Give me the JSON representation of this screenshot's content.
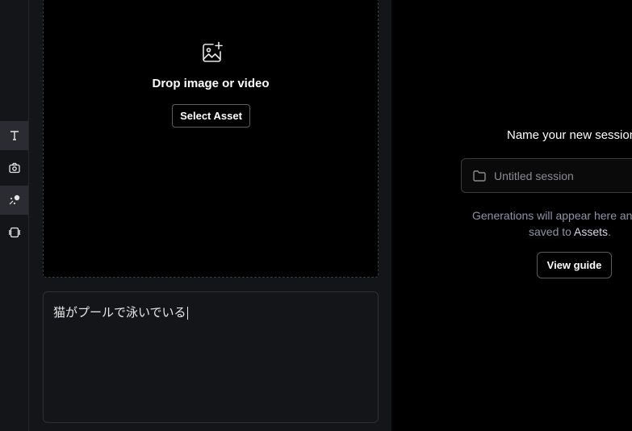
{
  "rail": {
    "items": [
      {
        "icon": "text-icon",
        "active": true
      },
      {
        "icon": "camera-icon",
        "active": false
      },
      {
        "icon": "motion-brush-icon",
        "active": true
      },
      {
        "icon": "layers-icon",
        "active": false
      }
    ]
  },
  "dropzone": {
    "icon": "image-add-icon",
    "title": "Drop image or video",
    "select_label": "Select Asset"
  },
  "prompt": {
    "value": "猫がプールで泳いでいる"
  },
  "session": {
    "title": "Name your new session",
    "placeholder": "Untitled session",
    "note_line1": "Generations will appear here and be",
    "note_line2_prefix": "saved to ",
    "note_link": "Assets",
    "note_suffix": ".",
    "guide_label": "View guide"
  },
  "colors": {
    "background": "#000000",
    "panel": "#141518",
    "muted_text": "#8f93a8"
  }
}
